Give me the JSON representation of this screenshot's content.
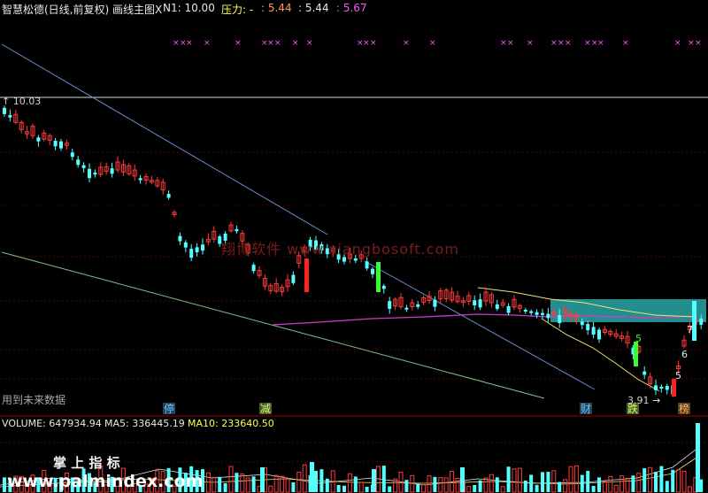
{
  "header": {
    "title": "智慧松德(日线,前复权) 画线主图X",
    "n1": "N1: 10.00",
    "pressure_label": "压力: -",
    "v1": ": 5.44",
    "v2": ": 5.44",
    "v3": ": 5.67"
  },
  "volume_header": {
    "volume": "VOLUME: 647934.94",
    "ma5": "MA5: 336445.19",
    "ma10": "MA10: 233640.50"
  },
  "notes": {
    "future_data": "用到未来数据",
    "watermark_site": "翔博软件 www.xiangbosoft.com",
    "watermark_palm": "掌 上 指 标",
    "watermark_palm_url": "www.palmindex.com"
  },
  "chart_data": {
    "type": "candlestick",
    "price_labels": {
      "high": "10.03",
      "low": "3.91",
      "extra": [
        "7",
        "6",
        "5",
        "5"
      ]
    },
    "signals": [
      "停",
      "减",
      "财",
      "跌",
      "榜"
    ],
    "colors": {
      "up": "#ff3a3a",
      "down": "#54ffff",
      "ma_yellow": "#e8e870",
      "ma_magenta": "#d03ad0",
      "trend_blue": "#6a8ed0",
      "trend_green": "#7ac48a",
      "pressure_box": "#2aa6a6"
    }
  }
}
